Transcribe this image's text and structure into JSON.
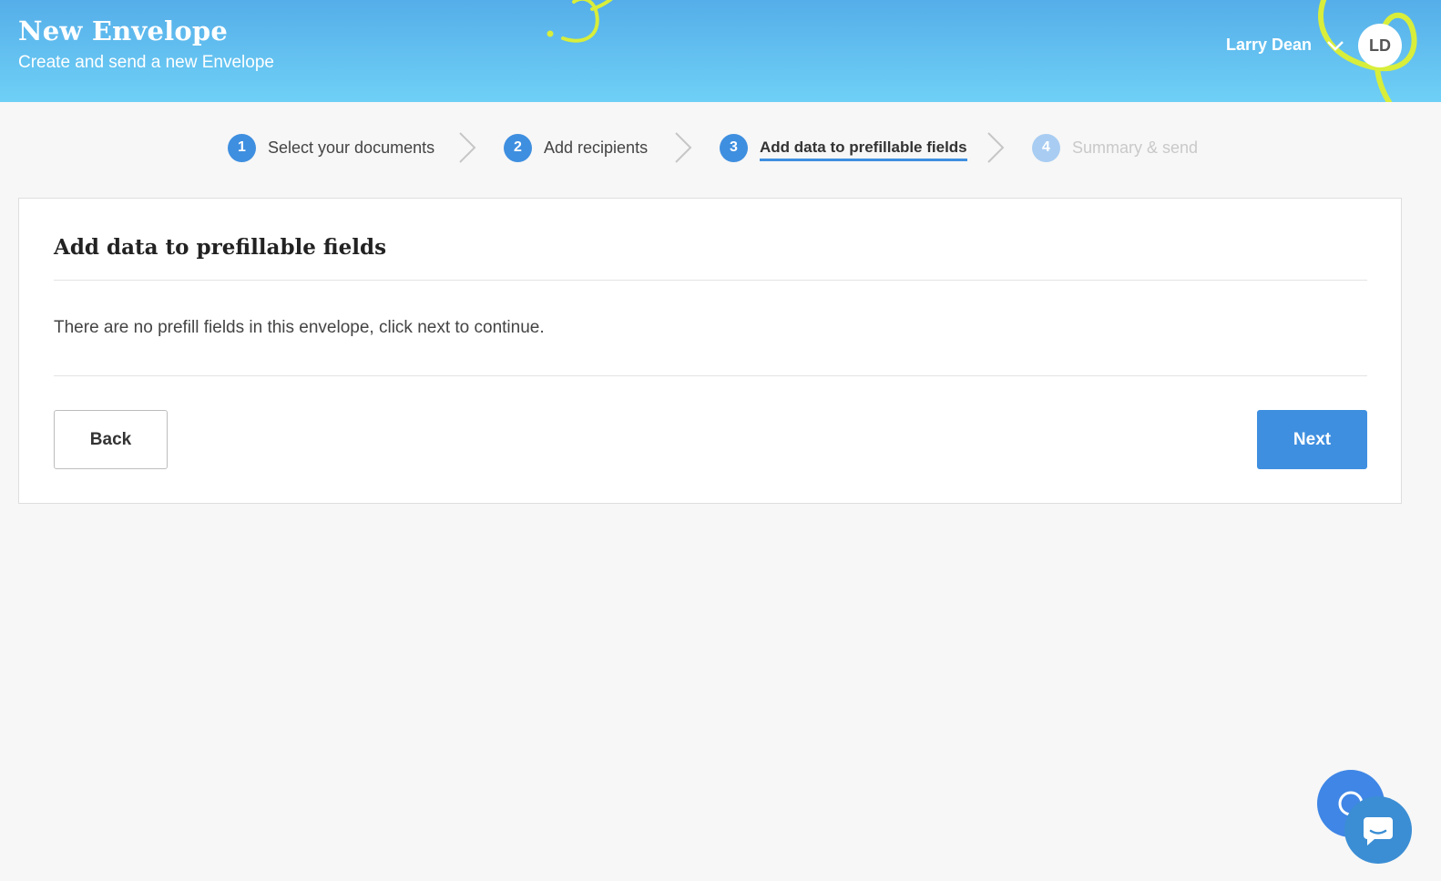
{
  "header": {
    "title": "New Envelope",
    "subtitle": "Create and send a new Envelope",
    "user_name": "Larry Dean",
    "avatar_initials": "LD",
    "chevron_icon": "chevron-down-icon"
  },
  "steps": [
    {
      "number": "1",
      "label": "Select your documents",
      "state": "done"
    },
    {
      "number": "2",
      "label": "Add recipients",
      "state": "done"
    },
    {
      "number": "3",
      "label": "Add data to prefillable fields",
      "state": "active"
    },
    {
      "number": "4",
      "label": "Summary & send",
      "state": "disabled"
    }
  ],
  "card": {
    "title": "Add data to prefillable fields",
    "message": "There are no prefill fields in this envelope, click next to continue.",
    "back_label": "Back",
    "next_label": "Next"
  },
  "chat": {
    "icon": "chat-bubble-icon"
  },
  "colors": {
    "accent": "#3f8fe0",
    "header_gradient_top": "#55aee9",
    "header_gradient_bottom": "#6fd0f6",
    "decoration": "#d4ec3c"
  }
}
